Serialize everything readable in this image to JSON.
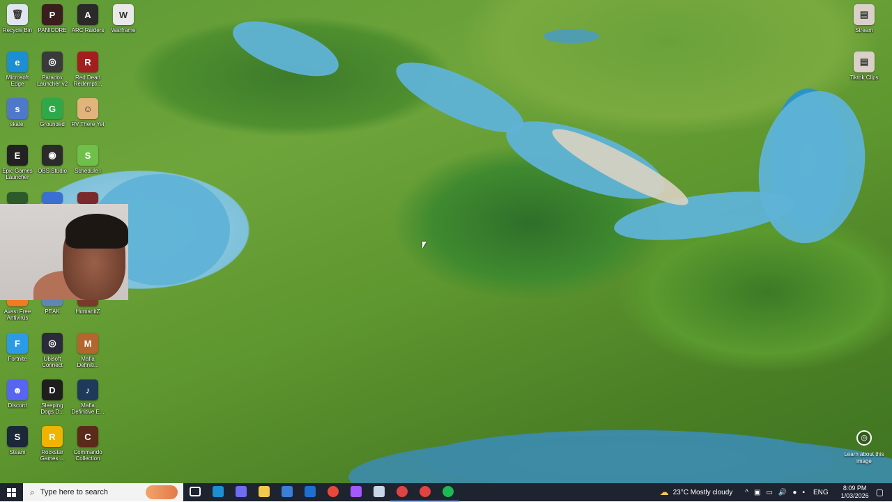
{
  "desktop": {
    "icons": [
      {
        "label": "Recycle Bin",
        "icon": "recycle-bin-icon",
        "color": "#dfe6ee",
        "glyph": "🗑"
      },
      {
        "label": "PANICORE",
        "icon": "panicore-icon",
        "color": "#3a1d1d",
        "glyph": "P"
      },
      {
        "label": "ARC Raiders",
        "icon": "arc-raiders-icon",
        "color": "#2a2a2a",
        "glyph": "A"
      },
      {
        "label": "Warframe",
        "icon": "warframe-icon",
        "color": "#e9e9e9",
        "glyph": "W"
      },
      {
        "label": "Microsoft Edge",
        "icon": "edge-icon",
        "color": "#1b8fd1",
        "glyph": "e"
      },
      {
        "label": "Paradox Launcher v2",
        "icon": "paradox-icon",
        "color": "#3a3a3a",
        "glyph": "◎"
      },
      {
        "label": "Red Dead Redempti...",
        "icon": "rdr-icon",
        "color": "#a31e1e",
        "glyph": "R"
      },
      {
        "label": "skate.",
        "icon": "skate-icon",
        "color": "#4e78c9",
        "glyph": "s"
      },
      {
        "label": "Grounded",
        "icon": "grounded-icon",
        "color": "#2fa84a",
        "glyph": "G"
      },
      {
        "label": "RV There Yet",
        "icon": "rv-there-yet-icon",
        "color": "#e0b47a",
        "glyph": "☺"
      },
      {
        "label": "Epic Games Launcher",
        "icon": "epic-games-icon",
        "color": "#222222",
        "glyph": "E"
      },
      {
        "label": "OBS Studio",
        "icon": "obs-icon",
        "color": "#2b2b2b",
        "glyph": "◉"
      },
      {
        "label": "Schedule I",
        "icon": "schedule-i-icon",
        "color": "#6fbf4a",
        "glyph": "S"
      },
      {
        "label": "Avast Free Antivirus",
        "icon": "avast-icon",
        "color": "#f07b22",
        "glyph": "a"
      },
      {
        "label": "PEAK",
        "icon": "peak-icon",
        "color": "#5e87b5",
        "glyph": "▲"
      },
      {
        "label": "HumanitZ",
        "icon": "humanitz-icon",
        "color": "#7a3a2a",
        "glyph": "H"
      },
      {
        "label": "Fortnite",
        "icon": "fortnite-icon",
        "color": "#2b9be8",
        "glyph": "F"
      },
      {
        "label": "Ubisoft Connect",
        "icon": "ubisoft-icon",
        "color": "#2a2a3a",
        "glyph": "◎"
      },
      {
        "label": "Mafia Definiti...",
        "icon": "mafia-icon",
        "color": "#b5652e",
        "glyph": "M"
      },
      {
        "label": "Discord",
        "icon": "discord-icon",
        "color": "#5865f2",
        "glyph": "☻"
      },
      {
        "label": "Sleeping Dogs D...",
        "icon": "sleeping-dogs-icon",
        "color": "#1e1e1e",
        "glyph": "D"
      },
      {
        "label": "Mafia Definitive E...",
        "icon": "mafia-music-icon",
        "color": "#1e3a5a",
        "glyph": "♪"
      },
      {
        "label": "Steam",
        "icon": "steam-icon",
        "color": "#1b2838",
        "glyph": "S"
      },
      {
        "label": "Rockstar Games ...",
        "icon": "rockstar-icon",
        "color": "#f0b400",
        "glyph": "R"
      },
      {
        "label": "Commando Collection",
        "icon": "commando-icon",
        "color": "#5a2a1a",
        "glyph": "C"
      },
      {
        "label": "Stream",
        "icon": "stream-icon",
        "color": "#d9d0c8",
        "glyph": "▤"
      },
      {
        "label": "Tiktok Clips",
        "icon": "tiktok-clips-icon",
        "color": "#d9d0c8",
        "glyph": "▤"
      }
    ],
    "learn": {
      "label": "Learn about this image"
    }
  },
  "taskbar": {
    "search_placeholder": "Type here to search",
    "apps": [
      {
        "name": "task-view",
        "color": "#ffffff"
      },
      {
        "name": "edge",
        "color": "#1b8fd1"
      },
      {
        "name": "copilot",
        "color": "#6f6cf2"
      },
      {
        "name": "file-explorer",
        "color": "#f2c94c"
      },
      {
        "name": "store",
        "color": "#3b7fd9"
      },
      {
        "name": "outlook",
        "color": "#1f6fd1"
      },
      {
        "name": "chrome",
        "color": "#e8493a"
      },
      {
        "name": "figma",
        "color": "#a259ff"
      },
      {
        "name": "app-8",
        "color": "#c9d6e8"
      },
      {
        "name": "capture",
        "color": "#e04343"
      },
      {
        "name": "chrome-red",
        "color": "#e04343"
      },
      {
        "name": "spotify",
        "color": "#1db954"
      }
    ],
    "weather": {
      "temp": "23°C",
      "desc": "Mostly cloudy"
    },
    "language": "ENG",
    "time": "8:09 PM",
    "date": "1/03/2026"
  }
}
